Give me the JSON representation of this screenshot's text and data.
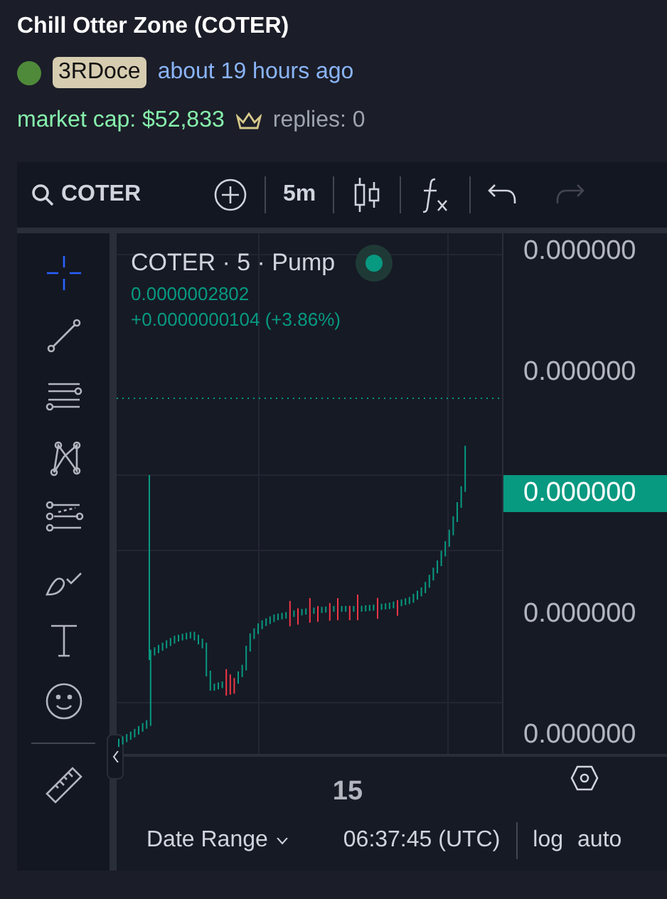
{
  "title": "Chill Otter Zone (COTER)",
  "creator": {
    "username": "3RDoce",
    "time": "about 19 hours ago"
  },
  "stats": {
    "market_cap": "market cap: $52,833",
    "replies": "replies: 0"
  },
  "chart": {
    "toolbar": {
      "symbol": "COTER",
      "interval": "5m"
    },
    "legend": {
      "title": "COTER · 5 · Pump",
      "live": true,
      "price": "0.0000002802",
      "change": "+0.0000000104 (+3.86%)"
    },
    "price_axis": [
      {
        "label": "0.000000",
        "current": false
      },
      {
        "label": "0.000000",
        "current": false
      },
      {
        "label": "0.000000",
        "current": true
      },
      {
        "label": "0.000000",
        "current": false
      },
      {
        "label": "0.000000",
        "current": false
      }
    ],
    "time_axis": [
      "15"
    ],
    "bottom_bar": {
      "date_range": "Date Range",
      "clock": "06:37:45 (UTC)",
      "buttons": [
        "log",
        "auto"
      ]
    }
  }
}
